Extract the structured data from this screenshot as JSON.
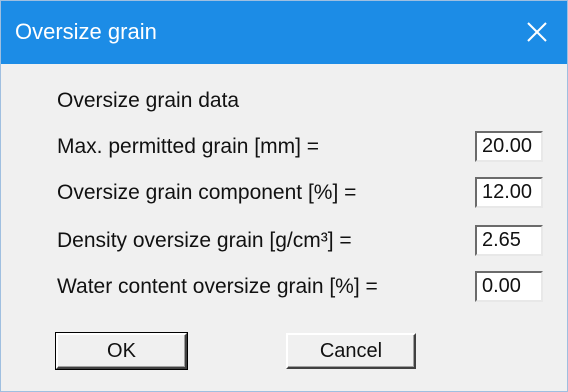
{
  "window": {
    "title": "Oversize grain",
    "close_icon": "close-icon",
    "title_bar_color": "#1c8ce6"
  },
  "group": {
    "label": "Oversize grain data"
  },
  "fields": [
    {
      "label": "Max. permitted grain [mm] =",
      "value": "20.00"
    },
    {
      "label": "Oversize grain component [%] =",
      "value": "12.00"
    },
    {
      "label": "Density oversize grain [g/cm³] =",
      "value": "2.65"
    },
    {
      "label": "Water content oversize grain [%] =",
      "value": "0.00"
    }
  ],
  "buttons": {
    "ok_label": "OK",
    "cancel_label": "Cancel"
  }
}
